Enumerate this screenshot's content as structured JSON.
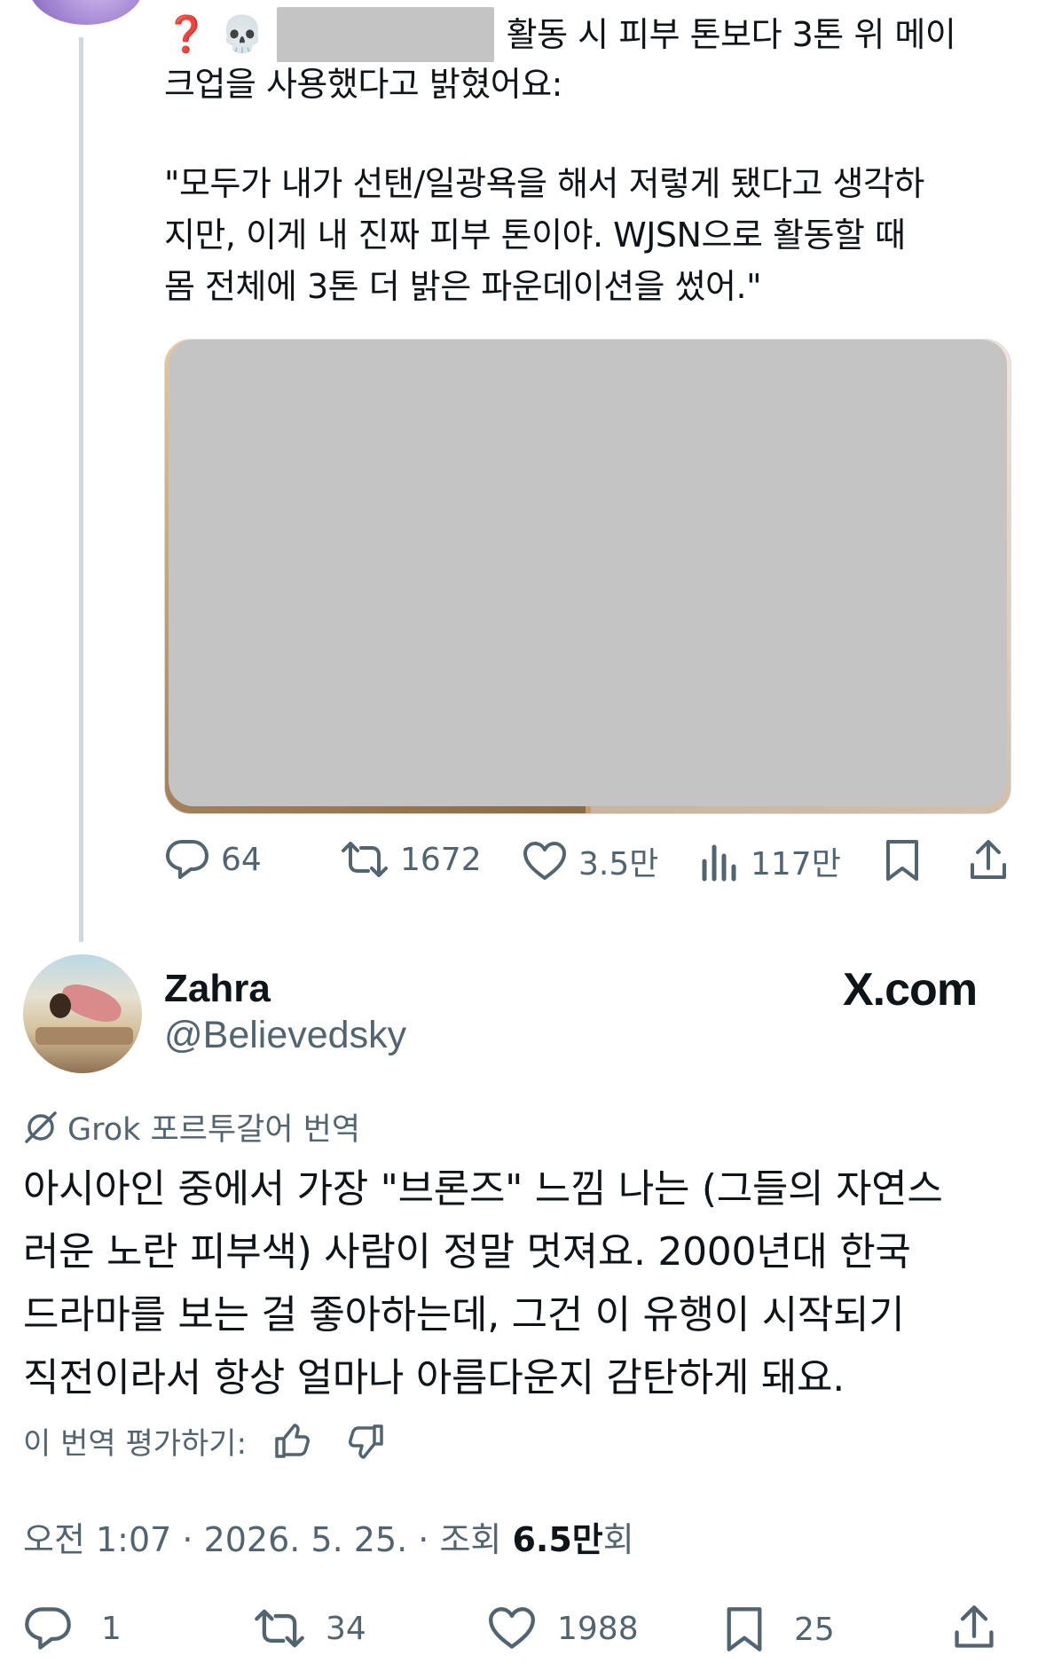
{
  "reply": {
    "line1_emoji1": "❓",
    "line1_emoji2": "💀",
    "line1_text": "활동 시 피부 톤보다 3톤 위 메이",
    "line2_text": "크업을 사용했다고 밝혔어요:",
    "quote_lines": [
      "\"모두가 내가 선탠/일광욕을 해서 저렇게 됐다고 생각하",
      "지만, 이게 내 진짜 피부 톤이야. WJSN으로 활동할 때",
      "몸 전체에 3톤 더 밝은 파운데이션을 썼어.\""
    ],
    "stats": {
      "replies": "64",
      "reposts": "1672",
      "likes": "3.5만",
      "views": "117만"
    }
  },
  "tweet": {
    "display_name": "Zahra",
    "handle": "@Believedsky",
    "watermark": "X.com",
    "grok_label": "Grok 포르투갈어 번역",
    "body_lines": [
      "아시아인 중에서 가장 \"브론즈\" 느낌 나는 (그들의 자연스",
      "러운 노란 피부색) 사람이 정말 멋져요. 2000년대 한국",
      "드라마를 보는 걸 좋아하는데, 그건 이 유행이 시작되기",
      "직전이라서 항상 얼마나 아름다운지 감탄하게 돼요."
    ],
    "rate_label": "이 번역 평가하기:",
    "meta_time": "오전 1:07 · 2026. 5. 25. · 조회 ",
    "meta_views": "6.5만",
    "meta_suffix": "회",
    "stats": {
      "replies": "1",
      "reposts": "34",
      "likes": "1988",
      "bookmarks": "25"
    }
  },
  "colors": {
    "text_primary": "#0f1419",
    "text_secondary": "#536471",
    "thread_line": "#cfd9de",
    "redaction": "#c4c4c4"
  }
}
